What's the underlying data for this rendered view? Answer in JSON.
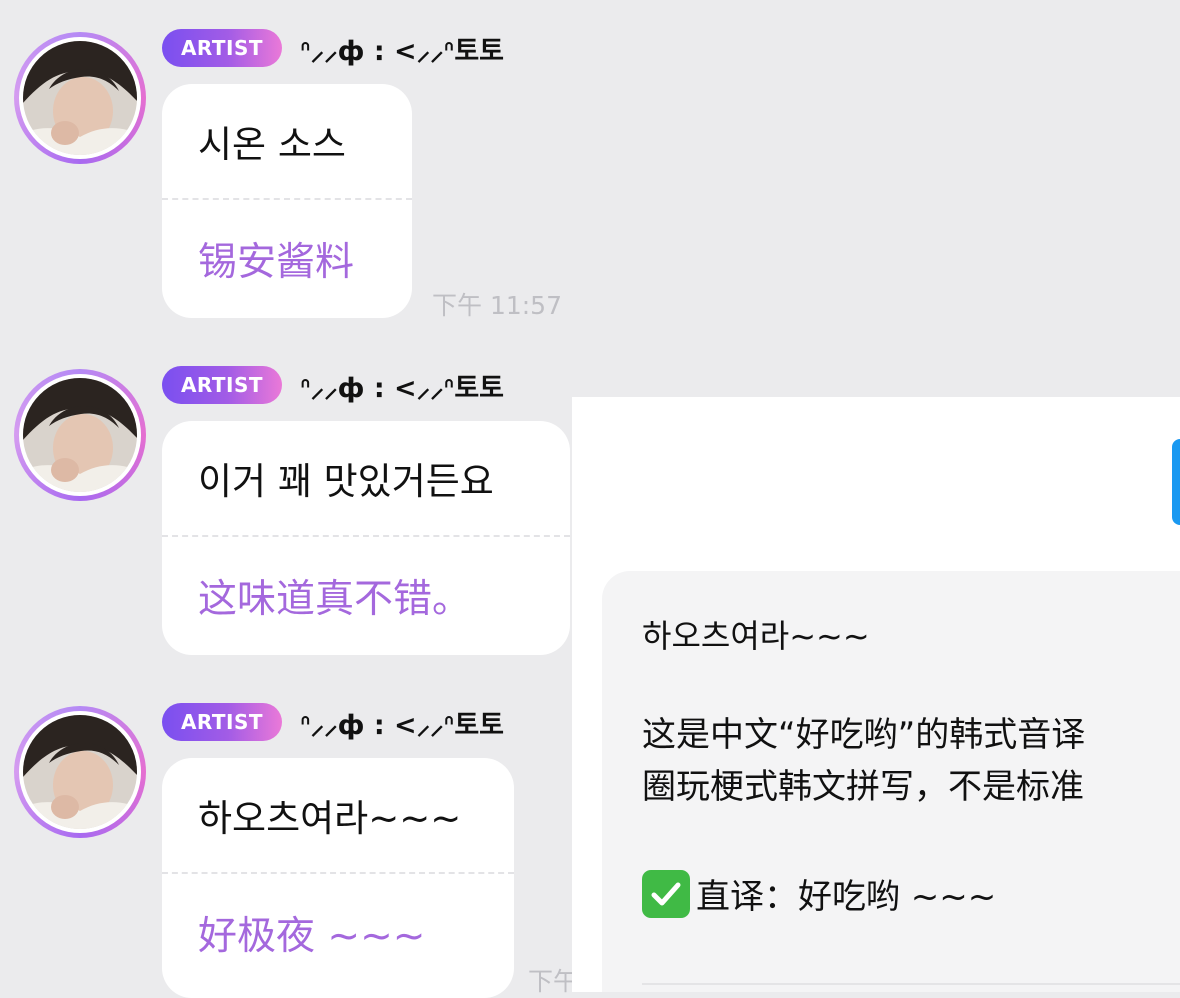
{
  "messages": [
    {
      "badge": "ARTIST",
      "sender": "ᐢ⸝⸝ф : <⸝⸝ᐢ토토",
      "original": "시온 소스",
      "translation": "锡安酱料",
      "time": "下午 11:57"
    },
    {
      "badge": "ARTIST",
      "sender": "ᐢ⸝⸝ф : <⸝⸝ᐢ토토",
      "original": "이거 꽤 맛있거든요",
      "translation": "这味道真不错。"
    },
    {
      "badge": "ARTIST",
      "sender": "ᐢ⸝⸝ф : <⸝⸝ᐢ토토",
      "original": "하오츠여라~~~",
      "translation": "好极夜 ~~~",
      "time": "下午"
    }
  ],
  "explanation": {
    "title": "하오츠여라~~~",
    "line1": "这是中文“好吃哟”的韩式音译",
    "line2": "圈玩梗式韩文拼写，不是标准",
    "literal": "直译：好吃哟 ~~~"
  },
  "colors": {
    "background": "#ebebed",
    "translation_text": "#a468dd",
    "badge_gradient_start": "#7a4ff0",
    "badge_gradient_end": "#ea79d8",
    "check_green": "#40ba45"
  },
  "icons": [
    "avatar-photo",
    "check-mark-icon"
  ]
}
